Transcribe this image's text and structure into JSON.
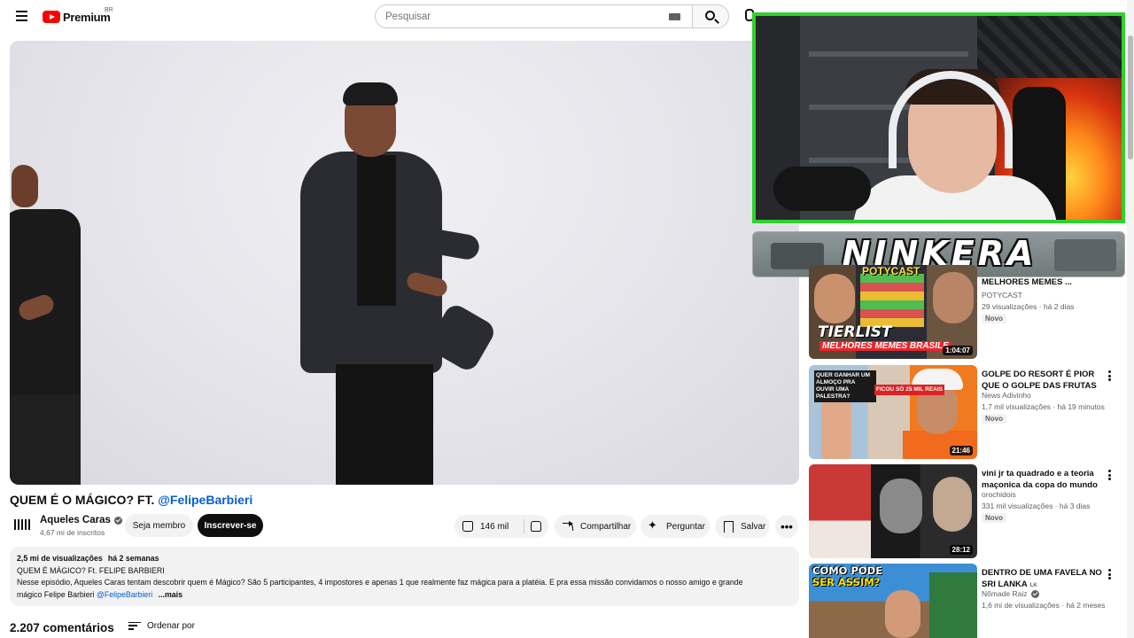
{
  "header": {
    "logo_text": "Premium",
    "country_code": "BR",
    "search_placeholder": "Pesquisar"
  },
  "overlay": {
    "banner_text": "NINKERA"
  },
  "video": {
    "title_prefix": "QUEM É O MÁGICO? FT. ",
    "title_mention": "@FelipeBarbieri",
    "channel_name": "Aqueles Caras",
    "subscribers": "4,67 mi de inscritos",
    "member_label": "Seja membro",
    "subscribe_label": "Inscrever-se",
    "likes": "146 mil",
    "share_label": "Compartilhar",
    "ask_label": "Perguntar",
    "save_label": "Salvar",
    "more_label": "•••"
  },
  "description": {
    "views": "2,5 mi de visualizações",
    "date": "há 2 semanas",
    "line1": "QUEM É MÁGICO? Ft. FELIPE BARBIERI",
    "line2": "Nesse episódio, Aqueles Caras tentam descobrir quem é Mágico? São 5 participantes, 4 impostores e apenas 1 que realmente faz mágica para a platéia. E pra essa missão convidamos o nosso amigo e grande",
    "line3": "mágico Felipe Barbieri ",
    "mention": "@FelipeBarbieri",
    "more": "...mais"
  },
  "comments": {
    "count": "2.207 comentários",
    "sort_label": "Ordenar por"
  },
  "recommendations": [
    {
      "title": "MELHORES MEMES ...",
      "channel": "POTYCAST",
      "views": "29 visualizações",
      "age": "há 2 dias",
      "badge": "Novo",
      "duration": "1:04:07",
      "thumb_text_1": "TIERLIST",
      "thumb_text_2": "MELHORES MEMES BRASILE",
      "thumb_text_3": "POTYCAST"
    },
    {
      "title": "GOLPE DO RESORT É PIOR QUE O GOLPE DAS FRUTAS",
      "channel": "News Adivinho",
      "views": "1,7 mil visualizações",
      "age": "há 19 minutos",
      "badge": "Novo",
      "duration": "21:46",
      "thumb_text_1": "QUER GANHAR UM ALMOÇO PRA OUVIR UMA PALESTRA?",
      "thumb_text_2": "FICOU SÓ 25 MIL REAIS"
    },
    {
      "title": "vini jr ta quadrado e a teoria maçonica da copa do mundo",
      "channel": "orochidois",
      "views": "331 mil visualizações",
      "age": "há 3 dias",
      "badge": "Novo",
      "duration": "28:12"
    },
    {
      "title": "DENTRO DE UMA FAVELA NO SRI LANKA",
      "title_suffix": "LK",
      "channel": "Nômade Raiz",
      "views": "1,6 mi de visualizações",
      "age": "há 2 meses",
      "thumb_text_1": "COMO PODE",
      "thumb_text_2": "SER ASSIM?"
    }
  ],
  "colors": {
    "accent_red": "#ff0000",
    "link_blue": "#065fd4",
    "overlay_border": "#2ed22e"
  }
}
